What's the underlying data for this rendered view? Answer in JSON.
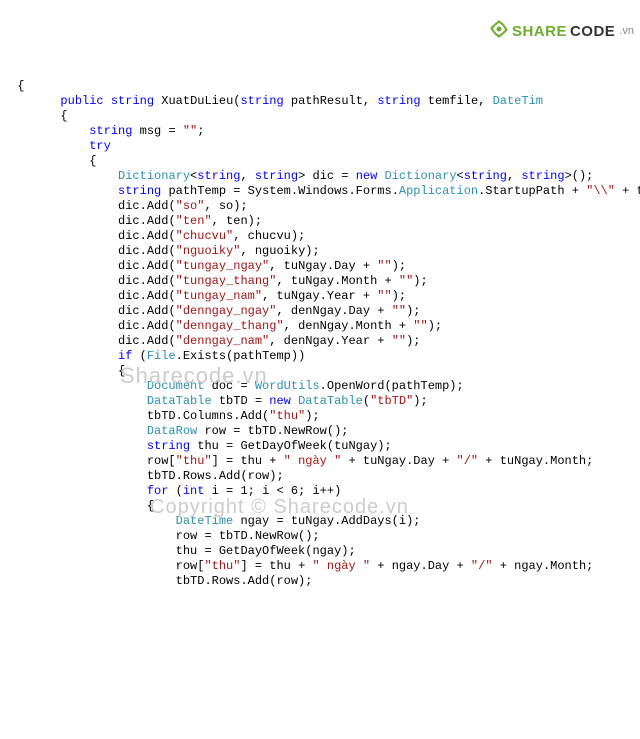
{
  "logo": {
    "share": "SHARE",
    "code": "CODE",
    "vn": ".vn"
  },
  "watermark1": "Sharecode.vn",
  "watermark2": "Copyright © Sharecode.vn",
  "c": {
    "l1a": "public",
    "l1b": "string",
    "l1c": " XuatDuLieu(",
    "l1d": "string",
    "l1e": " pathResult, ",
    "l1f": "string",
    "l1g": " temfile, ",
    "l1h": "DateTim",
    "l2": "{",
    "l3a": "string",
    "l3b": " msg = ",
    "l3c": "\"\"",
    "l3d": ";",
    "l4": "try",
    "l5": "{",
    "l6a": "Dictionary",
    "l6b": "<",
    "l6c": "string",
    "l6d": ", ",
    "l6e": "string",
    "l6f": "> dic = ",
    "l6g": "new",
    "l6h": " ",
    "l6i": "Dictionary",
    "l6j": "<",
    "l6k": "string",
    "l6l": ", ",
    "l6m": "string",
    "l6n": ">();",
    "l7a": "string",
    "l7b": " pathTemp = System.Windows.Forms.",
    "l7c": "Application",
    "l7d": ".StartupPath + ",
    "l7e": "\"\\\\\"",
    "l7f": " + temfile;",
    "l8a": "dic.Add(",
    "l8b": "\"so\"",
    "l8c": ", so);",
    "l9a": "dic.Add(",
    "l9b": "\"ten\"",
    "l9c": ", ten);",
    "l10a": "dic.Add(",
    "l10b": "\"chucvu\"",
    "l10c": ", chucvu);",
    "l11a": "dic.Add(",
    "l11b": "\"nguoiky\"",
    "l11c": ", nguoiky);",
    "l12a": "dic.Add(",
    "l12b": "\"tungay_ngay\"",
    "l12c": ", tuNgay.Day + ",
    "l12d": "\"\"",
    "l12e": ");",
    "l13a": "dic.Add(",
    "l13b": "\"tungay_thang\"",
    "l13c": ", tuNgay.Month + ",
    "l13d": "\"\"",
    "l13e": ");",
    "l14a": "dic.Add(",
    "l14b": "\"tungay_nam\"",
    "l14c": ", tuNgay.Year + ",
    "l14d": "\"\"",
    "l14e": ");",
    "l15a": "dic.Add(",
    "l15b": "\"denngay_ngay\"",
    "l15c": ", denNgay.Day + ",
    "l15d": "\"\"",
    "l15e": ");",
    "l16a": "dic.Add(",
    "l16b": "\"denngay_thang\"",
    "l16c": ", denNgay.Month + ",
    "l16d": "\"\"",
    "l16e": ");",
    "l17a": "dic.Add(",
    "l17b": "\"denngay_nam\"",
    "l17c": ", denNgay.Year + ",
    "l17d": "\"\"",
    "l17e": ");",
    "l18a": "if",
    "l18b": " (",
    "l18c": "File",
    "l18d": ".Exists(pathTemp))",
    "l19": "{",
    "l20a": "Document",
    "l20b": " doc = ",
    "l20c": "WordUtils",
    "l20d": ".OpenWord(pathTemp);",
    "l21a": "DataTable",
    "l21b": " tbTD = ",
    "l21c": "new",
    "l21d": " ",
    "l21e": "DataTable",
    "l21f": "(",
    "l21g": "\"tbTD\"",
    "l21h": ");",
    "l22a": "tbTD.Columns.Add(",
    "l22b": "\"thu\"",
    "l22c": ");",
    "l23a": "DataRow",
    "l23b": " row = tbTD.NewRow();",
    "l24a": "string",
    "l24b": " thu = GetDayOfWeek(tuNgay);",
    "l25a": "row[",
    "l25b": "\"thu\"",
    "l25c": "] = thu + ",
    "l25d": "\" ngày \"",
    "l25e": " + tuNgay.Day + ",
    "l25f": "\"/\"",
    "l25g": " + tuNgay.Month;",
    "l26": "tbTD.Rows.Add(row);",
    "l27a": "for",
    "l27b": " (",
    "l27c": "int",
    "l27d": " i = 1; i < 6; i++)",
    "l28": "{",
    "l29a": "DateTime",
    "l29b": " ngay = tuNgay.AddDays(i);",
    "l30": "row = tbTD.NewRow();",
    "l31": "thu = GetDayOfWeek(ngay);",
    "l32a": "row[",
    "l32b": "\"thu\"",
    "l32c": "] = thu + ",
    "l32d": "\" ngày \"",
    "l32e": " + ngay.Day + ",
    "l32f": "\"/\"",
    "l32g": " + ngay.Month;",
    "l33": "tbTD.Rows.Add(row);"
  }
}
